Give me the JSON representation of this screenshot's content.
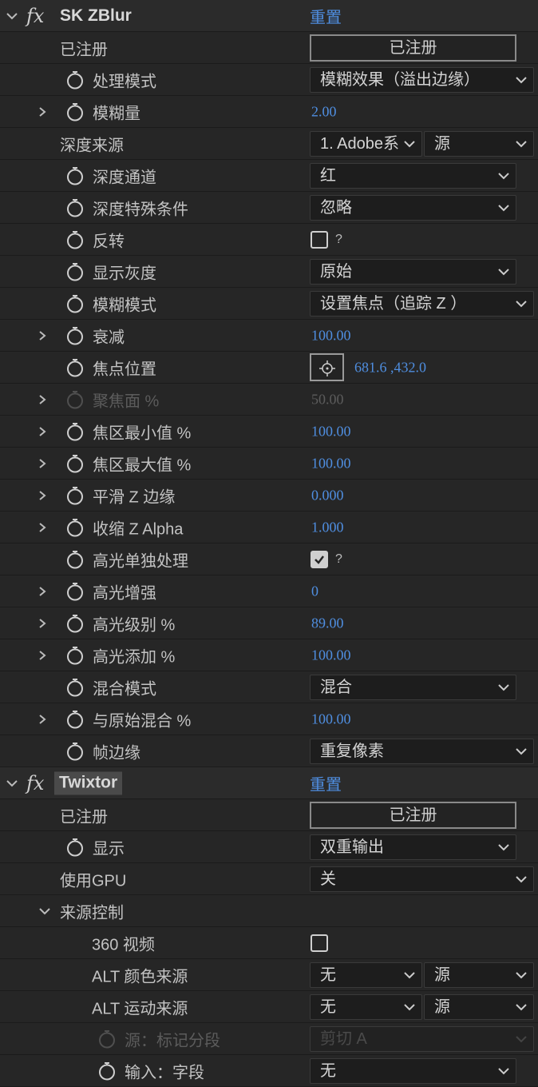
{
  "colors": {
    "accent": "#4f8ee0",
    "panel": "#262626",
    "header": "#2b2b2b"
  },
  "icons": {
    "expand": "chevron-right-icon",
    "collapse": "chevron-down-icon",
    "stopwatch": "stopwatch-icon",
    "fx": "fx-icon",
    "target": "crosshair-icon"
  },
  "skzblur": {
    "fx": "fx",
    "title": "SK ZBlur",
    "reset": "重置",
    "registered_label": "已注册",
    "registered_button": "已注册",
    "process_mode": {
      "label": "处理模式",
      "value": "模糊效果（溢出边缘）"
    },
    "blur_amount": {
      "label": "模糊量",
      "value": "2.00"
    },
    "depth_source": {
      "label": "深度来源",
      "layer": "1. Adobe系",
      "source": "源"
    },
    "depth_channel": {
      "label": "深度通道",
      "value": "红"
    },
    "depth_special": {
      "label": "深度特殊条件",
      "value": "忽略"
    },
    "invert": {
      "label": "反转",
      "checked": false,
      "help": "?"
    },
    "show_gray": {
      "label": "显示灰度",
      "value": "原始"
    },
    "blur_mode": {
      "label": "模糊模式",
      "value": "设置焦点（追踪 Z ）"
    },
    "falloff": {
      "label": "衰减",
      "value": "100.00"
    },
    "focus_point": {
      "label": "焦点位置",
      "value": "681.6 ,432.0"
    },
    "focal_plane": {
      "label": "聚焦面 %",
      "value": "50.00"
    },
    "focus_min": {
      "label": "焦区最小值 %",
      "value": "100.00"
    },
    "focus_max": {
      "label": "焦区最大值 %",
      "value": "100.00"
    },
    "smooth_z": {
      "label": "平滑 Z 边缘",
      "value": "0.000"
    },
    "shrink_z": {
      "label": "收缩 Z Alpha",
      "value": "1.000"
    },
    "highlight_separate": {
      "label": "高光单独处理",
      "checked": true,
      "help": "?"
    },
    "highlight_boost": {
      "label": "高光增强",
      "value": "0"
    },
    "highlight_level": {
      "label": "高光级别 %",
      "value": "89.00"
    },
    "highlight_add": {
      "label": "高光添加 %",
      "value": "100.00"
    },
    "blend_mode": {
      "label": "混合模式",
      "value": "混合"
    },
    "blend_original": {
      "label": "与原始混合 %",
      "value": "100.00"
    },
    "frame_edge": {
      "label": "帧边缘",
      "value": "重复像素"
    }
  },
  "twixtor": {
    "fx": "fx",
    "title": "Twixtor",
    "reset": "重置",
    "registered_label": "已注册",
    "registered_button": "已注册",
    "display": {
      "label": "显示",
      "value": "双重输出"
    },
    "use_gpu": {
      "label": "使用GPU",
      "value": "关"
    },
    "source_control": {
      "label": "来源控制"
    },
    "video360": {
      "label": "360 视频",
      "checked": false
    },
    "alt_color": {
      "label": "ALT 颜色来源",
      "layer": "无",
      "source": "源"
    },
    "alt_motion": {
      "label": "ALT 运动来源",
      "layer": "无",
      "source": "源"
    },
    "source_mark": {
      "label": "源：标记分段",
      "value": "剪切 A"
    },
    "input_field": {
      "label": "输入：字段",
      "value": "无"
    }
  }
}
